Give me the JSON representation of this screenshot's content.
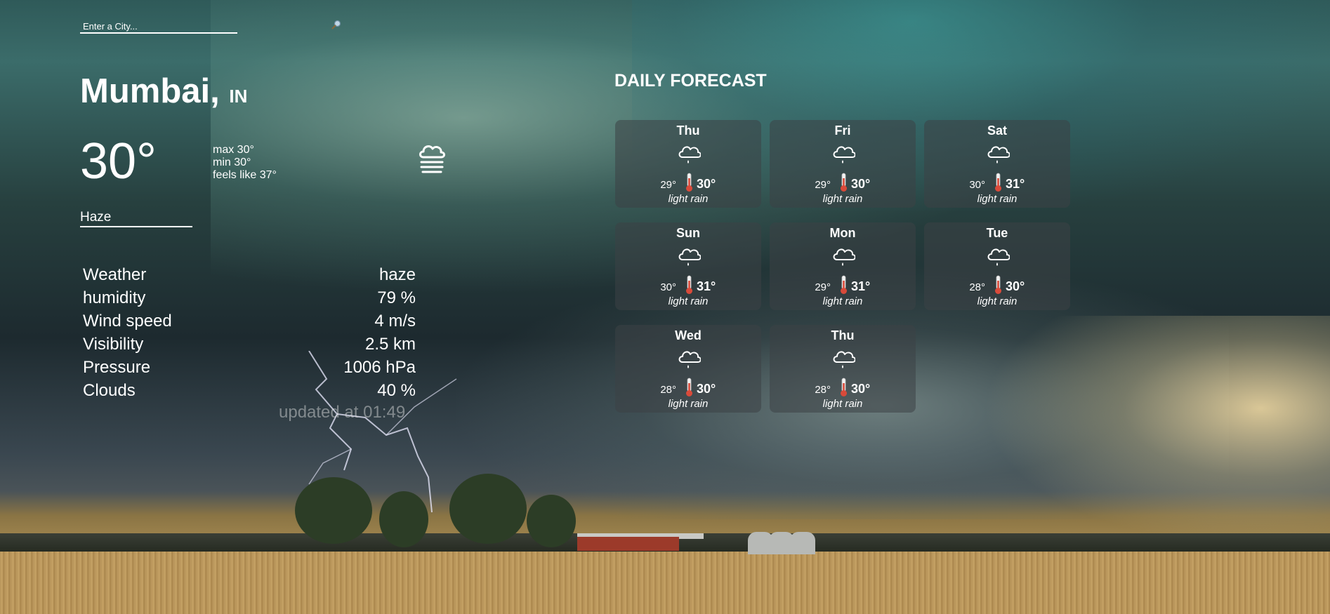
{
  "search": {
    "placeholder": "Enter a City..."
  },
  "location": {
    "city": "Mumbai,",
    "country": "IN"
  },
  "current": {
    "temp": "30°",
    "max": "max 30°",
    "min": "min 30°",
    "feels_like": "feels like 37°",
    "condition": "Haze",
    "icon": "haze-icon"
  },
  "details": [
    {
      "label": "Weather",
      "value": "haze"
    },
    {
      "label": "humidity",
      "value": "79 %"
    },
    {
      "label": "Wind speed",
      "value": "4 m/s"
    },
    {
      "label": "Visibility",
      "value": "2.5 km"
    },
    {
      "label": "Pressure",
      "value": "1006 hPa"
    },
    {
      "label": "Clouds",
      "value": "40 %"
    }
  ],
  "updated": "updated at 01:49",
  "forecast": {
    "title": "DAILY FORECAST",
    "days": [
      {
        "day": "Thu",
        "min": "29°",
        "max": "30°",
        "desc": "light rain",
        "icon": "rain-cloud-icon"
      },
      {
        "day": "Fri",
        "min": "29°",
        "max": "30°",
        "desc": "light rain",
        "icon": "rain-cloud-icon"
      },
      {
        "day": "Sat",
        "min": "30°",
        "max": "31°",
        "desc": "light rain",
        "icon": "rain-cloud-icon"
      },
      {
        "day": "Sun",
        "min": "30°",
        "max": "31°",
        "desc": "light rain",
        "icon": "rain-cloud-icon"
      },
      {
        "day": "Mon",
        "min": "29°",
        "max": "31°",
        "desc": "light rain",
        "icon": "rain-cloud-icon"
      },
      {
        "day": "Tue",
        "min": "28°",
        "max": "30°",
        "desc": "light rain",
        "icon": "rain-cloud-icon"
      },
      {
        "day": "Wed",
        "min": "28°",
        "max": "30°",
        "desc": "light rain",
        "icon": "rain-cloud-icon"
      },
      {
        "day": "Thu",
        "min": "28°",
        "max": "30°",
        "desc": "light rain",
        "icon": "rain-cloud-icon"
      }
    ]
  },
  "colors": {
    "card_bg": "#3c4146",
    "text": "#ffffff",
    "thermometer": "#d94a3a"
  }
}
